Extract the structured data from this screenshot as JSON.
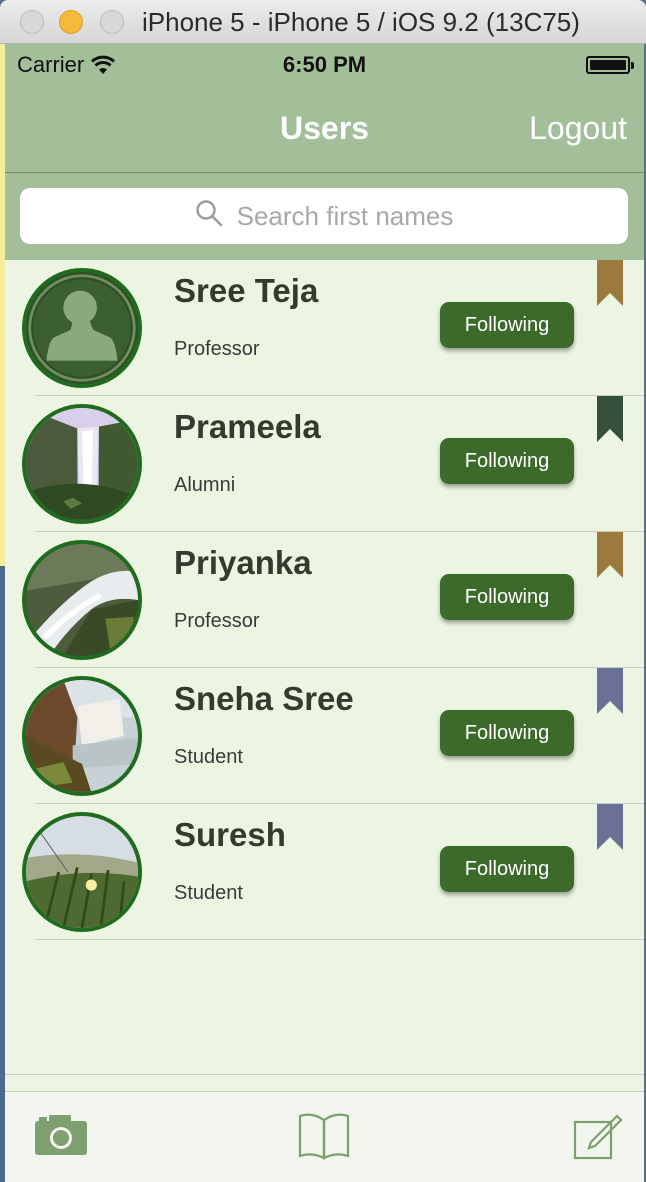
{
  "window": {
    "title": "iPhone 5 - iPhone 5 / iOS 9.2 (13C75)"
  },
  "status_bar": {
    "carrier": "Carrier",
    "time": "6:50 PM"
  },
  "nav": {
    "title": "Users",
    "right_button": "Logout"
  },
  "search": {
    "placeholder": "Search first names"
  },
  "users": [
    {
      "name": "Sree Teja",
      "role": "Professor",
      "button": "Following",
      "ribbon_color": "#9c7a3e",
      "avatar": "placeholder"
    },
    {
      "name": "Prameela",
      "role": "Alumni",
      "button": "Following",
      "ribbon_color": "#34503a",
      "avatar": "waterfall-1"
    },
    {
      "name": "Priyanka",
      "role": "Professor",
      "button": "Following",
      "ribbon_color": "#9c7a3e",
      "avatar": "waterfall-2"
    },
    {
      "name": "Sneha Sree",
      "role": "Student",
      "button": "Following",
      "ribbon_color": "#6b7096",
      "avatar": "waterfall-3"
    },
    {
      "name": "Suresh",
      "role": "Student",
      "button": "Following",
      "ribbon_color": "#6b7096",
      "avatar": "flower"
    }
  ],
  "tabbar": {
    "items": [
      "camera-icon",
      "book-icon",
      "compose-icon"
    ]
  },
  "colors": {
    "nav_background": "#a3bf99",
    "screen_background": "#ecf5e1",
    "button_background": "#3c6a2a",
    "avatar_border": "#1f6b1f"
  }
}
